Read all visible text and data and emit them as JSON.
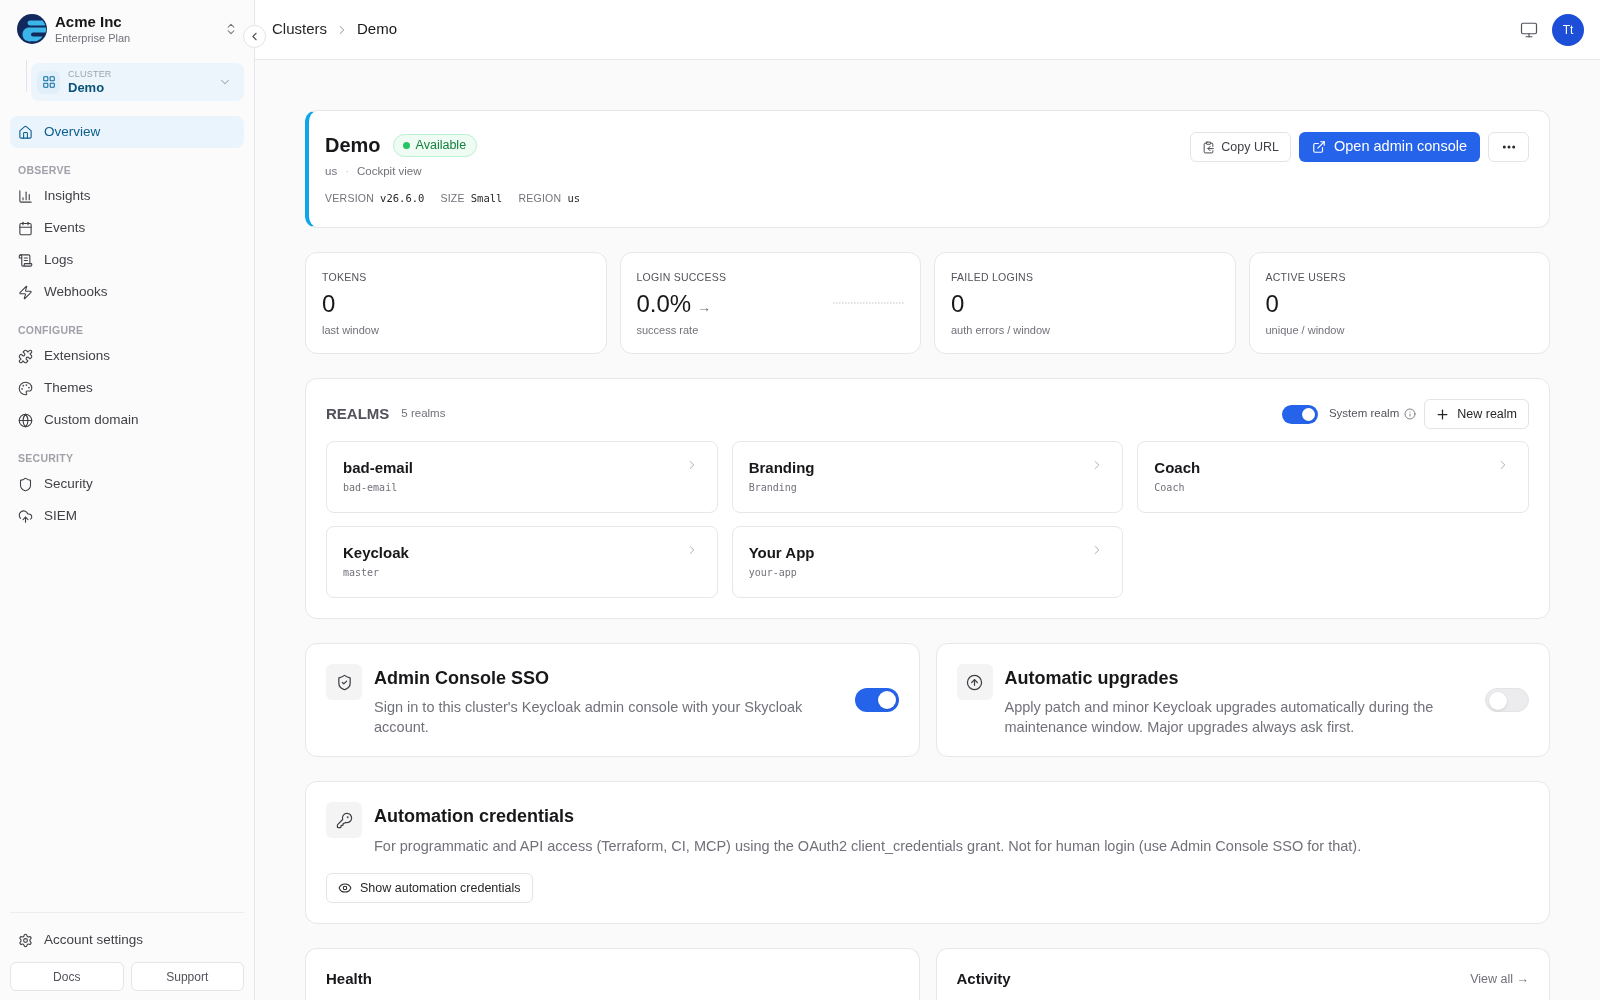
{
  "sidebar": {
    "org": {
      "name": "Acme Inc",
      "plan": "Enterprise Plan"
    },
    "cluster": {
      "label": "CLUSTER",
      "value": "Demo"
    },
    "overview": {
      "label": "Overview",
      "selected": true
    },
    "sections": [
      {
        "heading": "OBSERVE",
        "items": [
          {
            "label": "Insights",
            "selected": false
          },
          {
            "label": "Events",
            "selected": false
          },
          {
            "label": "Logs",
            "selected": false
          },
          {
            "label": "Webhooks",
            "selected": false
          }
        ]
      },
      {
        "heading": "CONFIGURE",
        "items": [
          {
            "label": "Extensions",
            "selected": false
          },
          {
            "label": "Themes",
            "selected": false
          },
          {
            "label": "Custom domain",
            "selected": false
          }
        ]
      },
      {
        "heading": "SECURITY",
        "items": [
          {
            "label": "Security",
            "selected": false
          },
          {
            "label": "SIEM",
            "selected": false
          }
        ]
      }
    ],
    "account_settings": "Account settings",
    "footer_buttons": [
      "Docs",
      "Support"
    ]
  },
  "topbar": {
    "breadcrumb": [
      "Clusters",
      "Demo"
    ],
    "avatar": "Tt"
  },
  "cluster_card": {
    "name": "Demo",
    "status": "Available",
    "region": "us",
    "separator": "·",
    "view": "Cockpit view",
    "meta": [
      {
        "label": "VERSION",
        "value": "v26.6.0"
      },
      {
        "label": "SIZE",
        "value": "Small"
      },
      {
        "label": "REGION",
        "value": "us"
      }
    ],
    "copy_button": "Copy URL",
    "open_button": "Open admin console"
  },
  "stats": [
    {
      "label": "TOKENS",
      "value": "0",
      "caption": "last window",
      "sparkline": false
    },
    {
      "label": "LOGIN SUCCESS",
      "value": "0.0%",
      "trend": "→",
      "caption": "success rate",
      "sparkline": true
    },
    {
      "label": "FAILED LOGINS",
      "value": "0",
      "caption": "auth errors / window",
      "sparkline": false
    },
    {
      "label": "ACTIVE USERS",
      "value": "0",
      "caption": "unique / window",
      "sparkline": false
    }
  ],
  "realms": {
    "title": "REALMS",
    "count": "5 realms",
    "system_realm": {
      "label": "System realm",
      "on": true
    },
    "new_button": "New realm",
    "items": [
      {
        "name": "bad-email",
        "id": "bad-email"
      },
      {
        "name": "Branding",
        "id": "Branding"
      },
      {
        "name": "Coach",
        "id": "Coach"
      },
      {
        "name": "Keycloak",
        "id": "master"
      },
      {
        "name": "Your App",
        "id": "your-app"
      }
    ]
  },
  "settings": [
    {
      "title": "Admin Console SSO",
      "description": "Sign in to this cluster's Keycloak admin console with your Skycloak account.",
      "on": true
    },
    {
      "title": "Automatic upgrades",
      "description": "Apply patch and minor Keycloak upgrades automatically during the maintenance window. Major upgrades always ask first.",
      "on": false
    }
  ],
  "credentials": {
    "title": "Automation credentials",
    "description": "For programmatic and API access (Terraform, CI, MCP) using the OAuth2 client_credentials grant. Not for human login (use Admin Console SSO for that).",
    "button": "Show automation credentials"
  },
  "health": {
    "title": "Health"
  },
  "activity": {
    "title": "Activity",
    "link": "View all →"
  }
}
